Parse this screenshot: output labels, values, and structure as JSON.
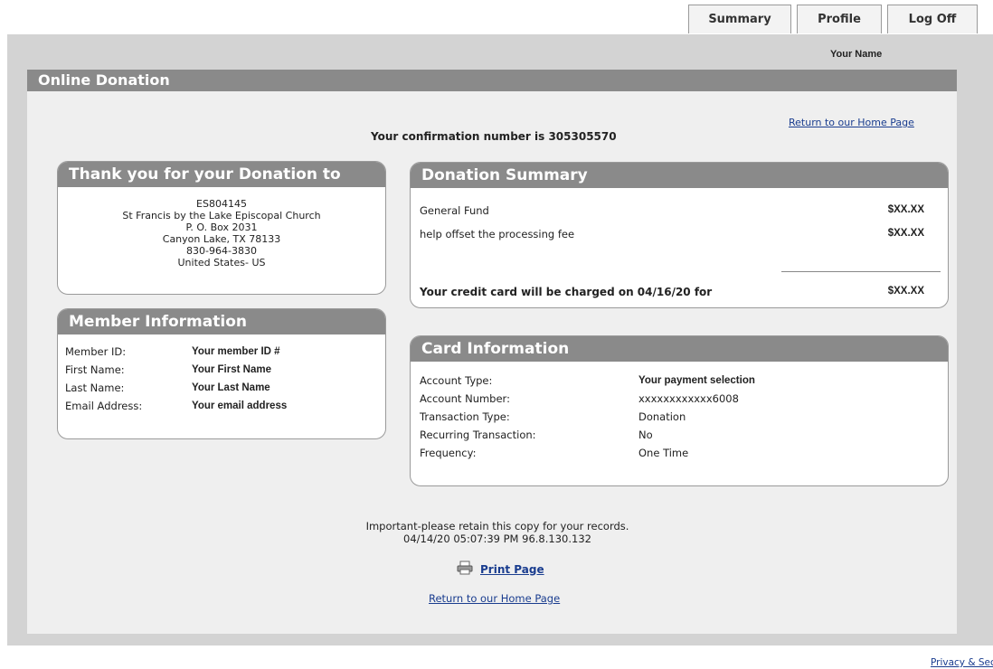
{
  "tabs": [
    "Summary",
    "Profile",
    "Log Off"
  ],
  "user": {
    "name": "Your Name"
  },
  "page_title": "Online Donation",
  "return_home_label": "Return to our Home Page",
  "confirmation_text": "Your confirmation number is 305305570",
  "thank_you": {
    "header": "Thank you for your Donation to",
    "lines": [
      "ES804145",
      "St Francis by the Lake Episcopal Church",
      "P. O. Box 2031",
      "Canyon Lake, TX 78133",
      "830-964-3830",
      "United States- US"
    ]
  },
  "member": {
    "header": "Member Information",
    "rows": [
      {
        "label": "Member ID:",
        "value": "Your member ID #"
      },
      {
        "label": "First Name:",
        "value": "Your First Name"
      },
      {
        "label": "Last Name:",
        "value": "Your Last Name"
      },
      {
        "label": "Email Address:",
        "value": "Your email address"
      }
    ]
  },
  "summary": {
    "header": "Donation Summary",
    "items": [
      {
        "label": "General Fund",
        "amount": "$XX.XX"
      },
      {
        "label": "help offset the processing fee",
        "amount": "$XX.XX"
      }
    ],
    "charge_text": "Your credit card will be charged on 04/16/20 for",
    "charge_amount": "$XX.XX"
  },
  "card": {
    "header": "Card Information",
    "rows": [
      {
        "label": "Account Type:",
        "value": "Your payment selection"
      },
      {
        "label": "Account Number:",
        "value": "xxxxxxxxxxxx6008"
      },
      {
        "label": "Transaction Type:",
        "value": "Donation"
      },
      {
        "label": "Recurring Transaction:",
        "value": "No"
      },
      {
        "label": "Frequency:",
        "value": "One Time"
      }
    ]
  },
  "footer": {
    "note": "Important-please retain this copy for your records.",
    "timestamp": "04/14/20 05:07:39 PM 96.8.130.132",
    "print_label": "Print Page",
    "print_icon": "printer-icon",
    "privacy_label": "Privacy & Security"
  },
  "colors": {
    "header_bg": "#8a8a8a",
    "link": "#1a3d8f",
    "panel_bg": "#efefef",
    "frame_bg": "#d3d3d3"
  }
}
